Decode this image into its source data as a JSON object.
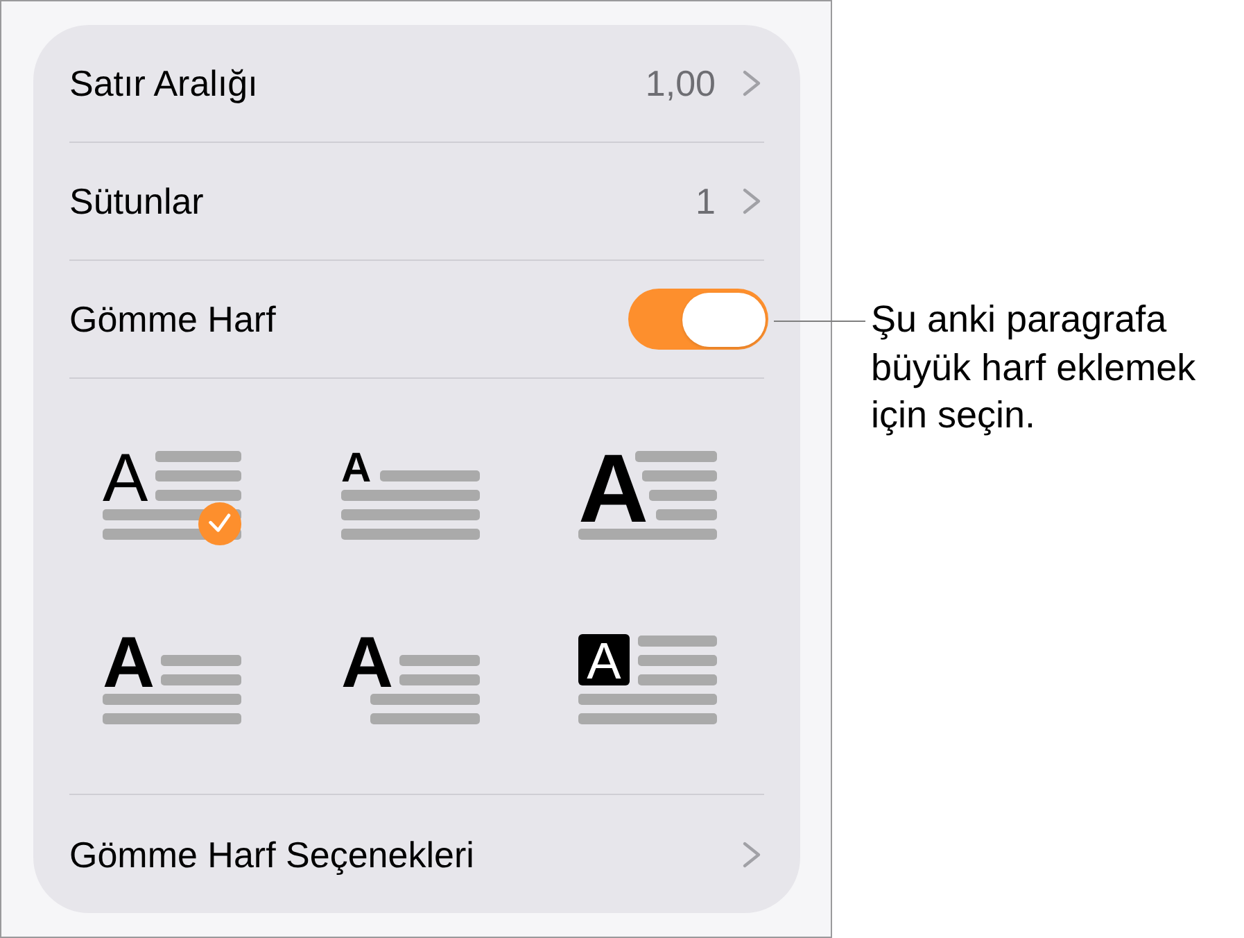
{
  "settings": [
    {
      "kind": "value",
      "label": "Satır Aralığı",
      "value": "1,00"
    },
    {
      "kind": "value",
      "label": "Sütunlar",
      "value": "1"
    },
    {
      "kind": "toggle",
      "label": "Gömme Harf",
      "on": true
    }
  ],
  "drop_cap_styles": [
    {
      "kind": "regular",
      "letter": "A",
      "selected": true
    },
    {
      "kind": "raised",
      "letter": "A",
      "selected": false
    },
    {
      "kind": "large",
      "letter": "A",
      "selected": false
    },
    {
      "kind": "bold",
      "letter": "A",
      "selected": false
    },
    {
      "kind": "hanging",
      "letter": "A",
      "selected": false
    },
    {
      "kind": "boxed",
      "letter": "A",
      "selected": false
    }
  ],
  "options_row": {
    "label": "Gömme Harf Seçenekleri"
  },
  "callout": {
    "lines": [
      "Şu anki paragrafa",
      "büyük harf eklemek",
      "için seçin."
    ]
  }
}
